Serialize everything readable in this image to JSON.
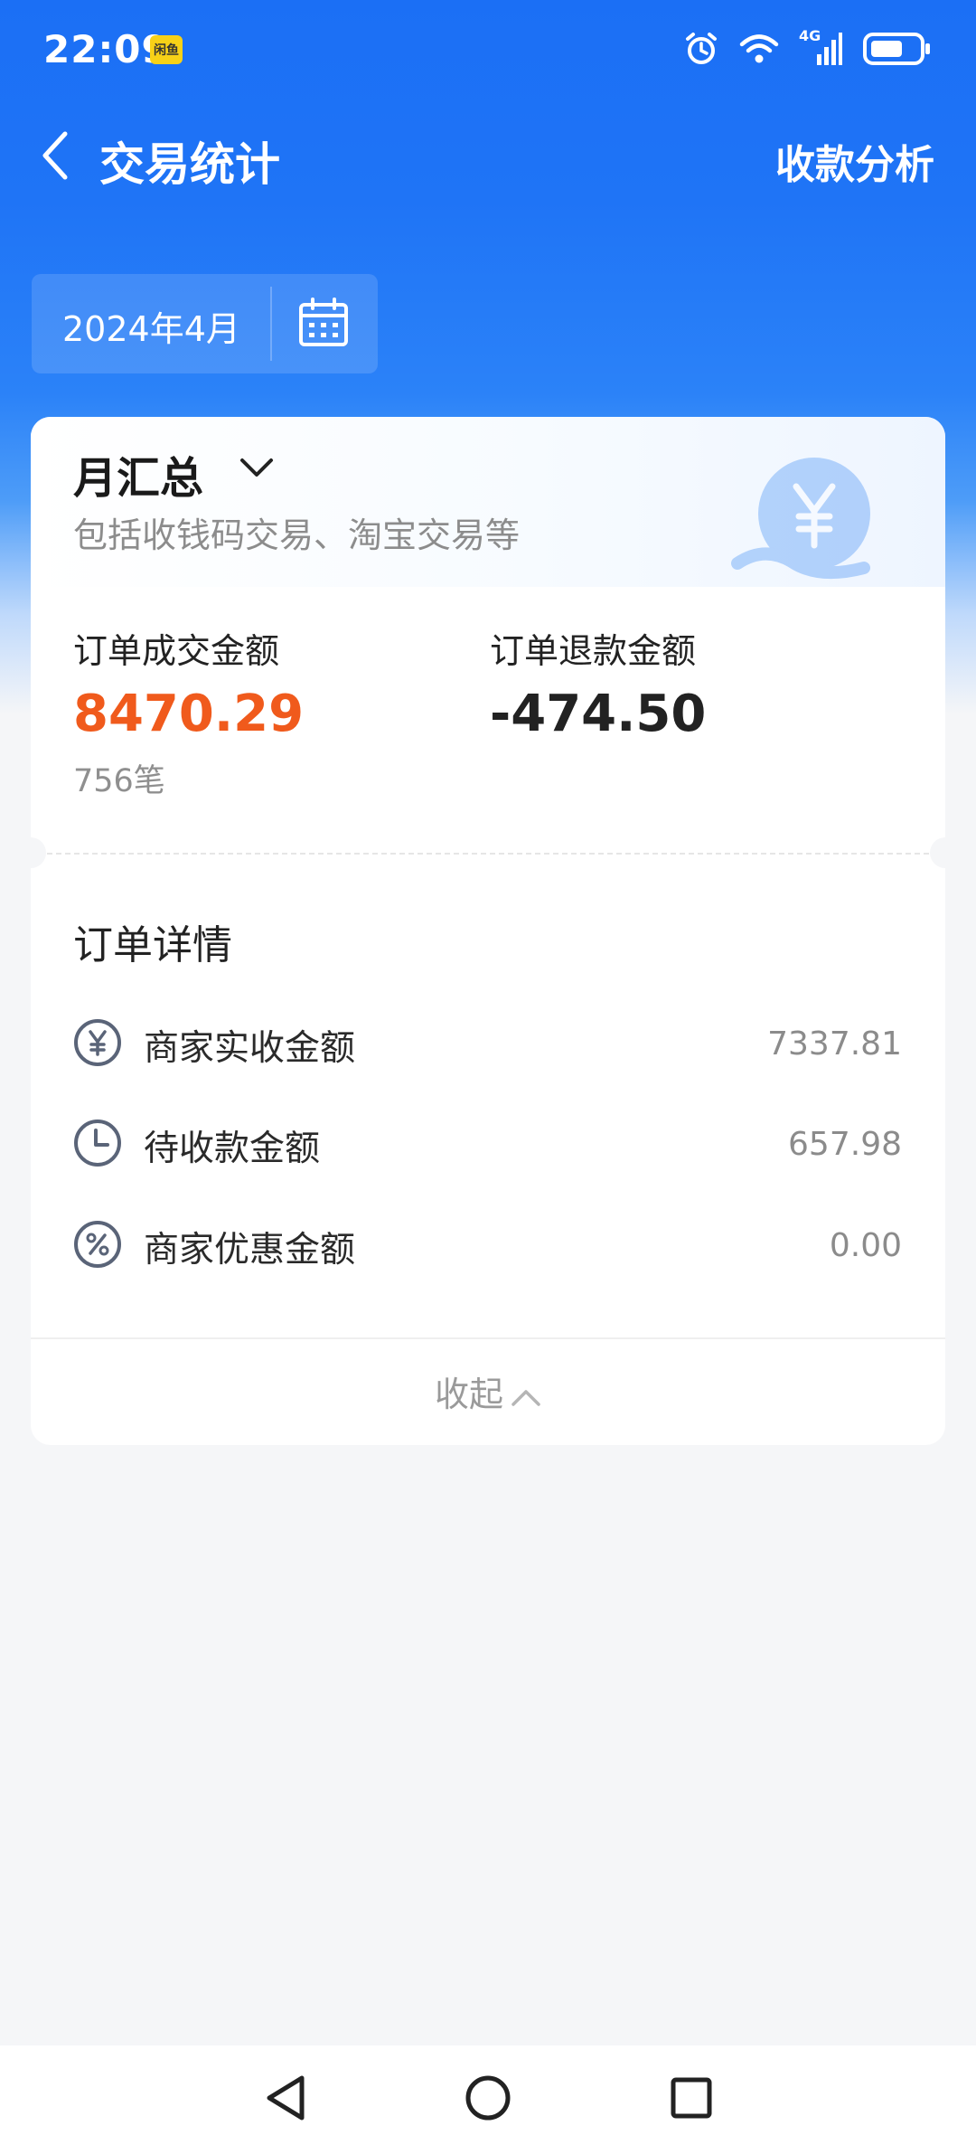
{
  "status_bar": {
    "time": "22:09",
    "badge_text": "闲鱼",
    "network": "4G"
  },
  "header": {
    "title": "交易统计",
    "right_action": "收款分析"
  },
  "date_selector": {
    "value": "2024年4月"
  },
  "summary": {
    "title": "月汇总",
    "subtitle": "包括收钱码交易、淘宝交易等",
    "order_amount_label": "订单成交金额",
    "order_amount_value": "8470.29",
    "order_count": "756笔",
    "refund_label": "订单退款金额",
    "refund_value": "-474.50"
  },
  "details": {
    "title": "订单详情",
    "items": [
      {
        "icon": "yen-circle-icon",
        "label": "商家实收金额",
        "value": "7337.81"
      },
      {
        "icon": "clock-icon",
        "label": "待收款金额",
        "value": "657.98"
      },
      {
        "icon": "percent-circle-icon",
        "label": "商家优惠金额",
        "value": "0.00"
      }
    ],
    "collapse_label": "收起"
  },
  "colors": {
    "brand_blue": "#1b6ff5",
    "amount_red": "#f05a1c"
  }
}
